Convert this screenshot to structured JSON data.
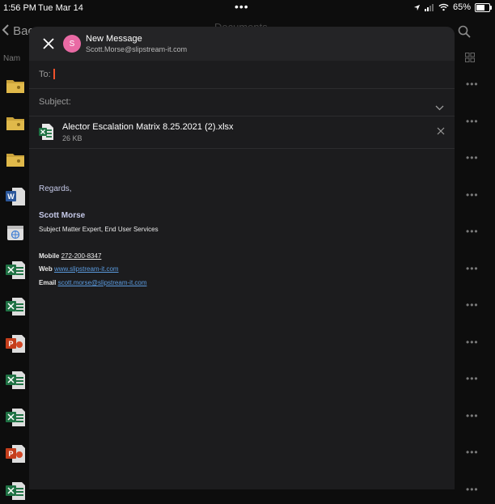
{
  "status_bar": {
    "time": "1:56 PM",
    "date": "Tue Mar 14",
    "battery_text": "65%",
    "battery_level": 0.65
  },
  "background": {
    "back_label": "Bac",
    "title": "Documents",
    "column_header": "Nam",
    "file_icons": [
      "folder-icon",
      "folder-icon",
      "folder-icon",
      "word-icon",
      "web-icon",
      "excel-icon",
      "excel-icon",
      "powerpoint-icon",
      "excel-icon",
      "excel-icon",
      "powerpoint-icon",
      "excel-icon"
    ]
  },
  "compose": {
    "title": "New Message",
    "avatar_initial": "S",
    "from": "Scott.Morse@slipstream-it.com",
    "to_label": "To:",
    "subject_label": "Subject:",
    "attachment": {
      "name": "Alector Escalation Matrix 8.25.2021 (2).xlsx",
      "size": "26 KB"
    },
    "body": {
      "regards": "Regards,",
      "signature_name": "Scott Morse",
      "signature_role": "Subject Matter Expert, End User Services",
      "mobile_label": "Mobile",
      "mobile_value": "272-200-8347",
      "web_label": "Web",
      "web_value": "www.slipstream-it.com",
      "email_label": "Email",
      "email_value": "scott.morse@slipstream-it.com"
    }
  },
  "colors": {
    "accent_cursor": "#f0522c",
    "link": "#5b9bdf",
    "avatar": "#e96aa4"
  }
}
